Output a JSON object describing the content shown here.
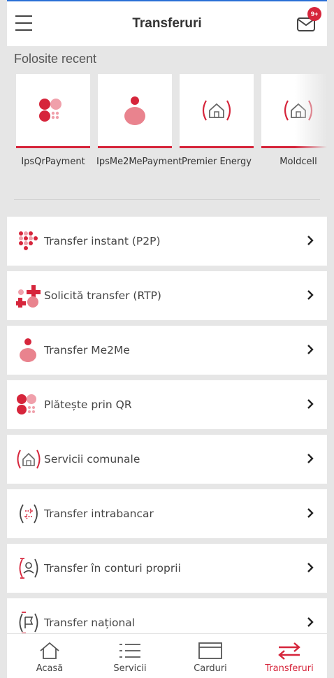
{
  "header": {
    "title": "Transferuri",
    "badge": "9+"
  },
  "recent": {
    "title": "Folosite recent",
    "items": [
      {
        "label": "IpsQrPayment",
        "icon": "qr-payment-icon"
      },
      {
        "label": "IpsMe2MePayment",
        "icon": "me2me-icon"
      },
      {
        "label": "Premier Energy",
        "icon": "utility-house-icon"
      },
      {
        "label": "Moldcell",
        "icon": "utility-house-icon"
      }
    ]
  },
  "menu": [
    {
      "label": "Transfer instant (P2P)",
      "icon": "p2p-dots-icon"
    },
    {
      "label": "Solicită transfer (RTP)",
      "icon": "rtp-icon"
    },
    {
      "label": "Transfer Me2Me",
      "icon": "me2me-icon"
    },
    {
      "label": "Plătește prin QR",
      "icon": "qr-payment-icon"
    },
    {
      "label": "Servicii comunale",
      "icon": "utility-house-icon"
    },
    {
      "label": "Transfer intrabancar",
      "icon": "intrabank-arrows-icon"
    },
    {
      "label": "Transfer în conturi proprii",
      "icon": "own-accounts-icon"
    },
    {
      "label": "Transfer național",
      "icon": "national-transfer-icon"
    }
  ],
  "tabs": [
    {
      "label": "Acasă",
      "icon": "home-icon"
    },
    {
      "label": "Servicii",
      "icon": "list-icon"
    },
    {
      "label": "Carduri",
      "icon": "card-icon"
    },
    {
      "label": "Transferuri",
      "icon": "transfer-arrows-icon",
      "active": true
    }
  ],
  "colors": {
    "accent": "#d6253b",
    "accent_light": "#f0a0ab",
    "topline": "#2a6fd6",
    "background": "#e6e6e6"
  }
}
